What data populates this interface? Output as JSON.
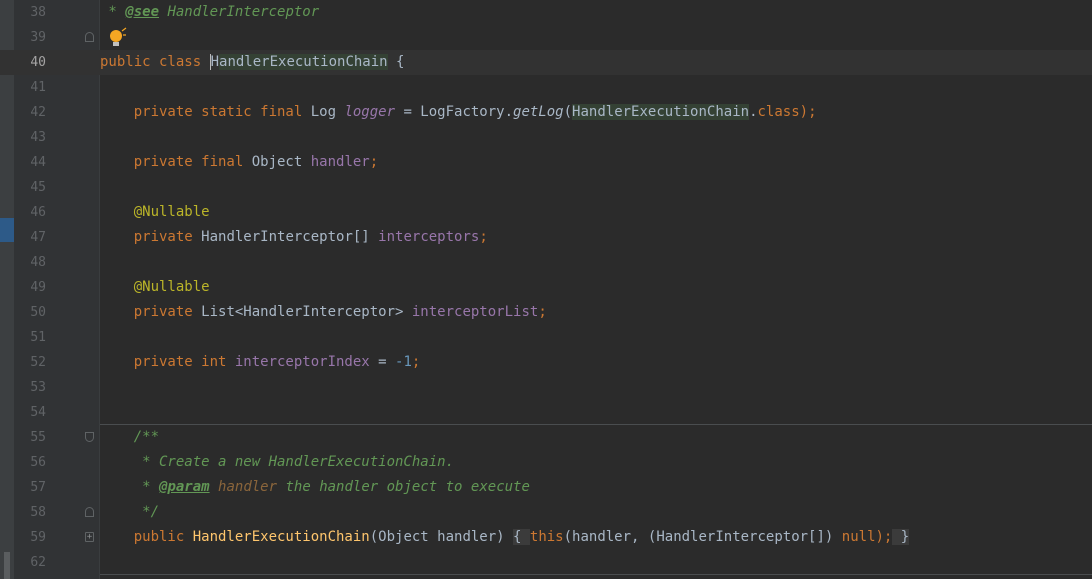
{
  "editor": {
    "lines": [
      {
        "num": "38",
        "parts": [
          {
            "t": " * ",
            "c": "doc"
          },
          {
            "t": "@see",
            "c": "doctag"
          },
          {
            "t": " HandlerInterceptor",
            "c": "doc"
          }
        ]
      },
      {
        "num": "39",
        "parts": [],
        "bulb": true,
        "fold": "up"
      },
      {
        "num": "40",
        "current": true,
        "parts": [
          {
            "t": "public class ",
            "c": "kw"
          },
          {
            "t": "H",
            "c": "caret"
          },
          {
            "t": "andlerExecutionChain",
            "c": "hl"
          },
          {
            "t": " {",
            "c": ""
          }
        ]
      },
      {
        "num": "41",
        "parts": []
      },
      {
        "num": "42",
        "parts": [
          {
            "t": "    private static final ",
            "c": "kw"
          },
          {
            "t": "Log ",
            "c": ""
          },
          {
            "t": "logger",
            "c": "static-field"
          },
          {
            "t": " = LogFactory.",
            "c": ""
          },
          {
            "t": "getLog",
            "c": "italic"
          },
          {
            "t": "(",
            "c": ""
          },
          {
            "t": "HandlerExecutionChain",
            "c": "hl"
          },
          {
            "t": ".",
            "c": ""
          },
          {
            "t": "class",
            "c": "kw"
          },
          {
            "t": ");",
            "c": "kw"
          }
        ]
      },
      {
        "num": "43",
        "parts": []
      },
      {
        "num": "44",
        "parts": [
          {
            "t": "    private final ",
            "c": "kw"
          },
          {
            "t": "Object ",
            "c": ""
          },
          {
            "t": "handler",
            "c": "field"
          },
          {
            "t": ";",
            "c": "kw"
          }
        ]
      },
      {
        "num": "45",
        "parts": []
      },
      {
        "num": "46",
        "parts": [
          {
            "t": "    @Nullable",
            "c": "ann"
          }
        ]
      },
      {
        "num": "47",
        "parts": [
          {
            "t": "    private ",
            "c": "kw"
          },
          {
            "t": "HandlerInterceptor[] ",
            "c": ""
          },
          {
            "t": "interceptors",
            "c": "field"
          },
          {
            "t": ";",
            "c": "kw"
          }
        ]
      },
      {
        "num": "48",
        "parts": []
      },
      {
        "num": "49",
        "parts": [
          {
            "t": "    @Nullable",
            "c": "ann"
          }
        ]
      },
      {
        "num": "50",
        "parts": [
          {
            "t": "    private ",
            "c": "kw"
          },
          {
            "t": "List<HandlerInterceptor> ",
            "c": ""
          },
          {
            "t": "interceptorList",
            "c": "field"
          },
          {
            "t": ";",
            "c": "kw"
          }
        ]
      },
      {
        "num": "51",
        "parts": []
      },
      {
        "num": "52",
        "parts": [
          {
            "t": "    private int ",
            "c": "kw"
          },
          {
            "t": "interceptorIndex",
            "c": "field"
          },
          {
            "t": " = ",
            "c": ""
          },
          {
            "t": "-1",
            "c": "num"
          },
          {
            "t": ";",
            "c": "kw"
          }
        ]
      },
      {
        "num": "53",
        "parts": []
      },
      {
        "num": "54",
        "parts": [],
        "separator": true
      },
      {
        "num": "55",
        "fold": "down",
        "parts": [
          {
            "t": "    /**",
            "c": "doc"
          }
        ]
      },
      {
        "num": "56",
        "parts": [
          {
            "t": "     * Create a new HandlerExecutionChain.",
            "c": "doc"
          }
        ]
      },
      {
        "num": "57",
        "parts": [
          {
            "t": "     * ",
            "c": "doc"
          },
          {
            "t": "@param",
            "c": "doctag"
          },
          {
            "t": " ",
            "c": "doc"
          },
          {
            "t": "handler",
            "c": "docparam"
          },
          {
            "t": " the handler object to execute",
            "c": "doc"
          }
        ]
      },
      {
        "num": "58",
        "fold": "up",
        "parts": [
          {
            "t": "     */",
            "c": "doc"
          }
        ]
      },
      {
        "num": "59",
        "fold": "plus",
        "parts": [
          {
            "t": "    public ",
            "c": "kw"
          },
          {
            "t": "HandlerExecutionChain",
            "c": "method"
          },
          {
            "t": "(Object handler) ",
            "c": ""
          },
          {
            "t": "{ ",
            "c": "brace-box"
          },
          {
            "t": "this",
            "c": "kw"
          },
          {
            "t": "(handler, ",
            "c": ""
          },
          {
            "t": "(HandlerInterceptor[]) ",
            "c": ""
          },
          {
            "t": "null",
            "c": "kw"
          },
          {
            "t": ");",
            "c": "kw"
          },
          {
            "t": " }",
            "c": "brace-box"
          }
        ]
      },
      {
        "num": "62",
        "parts": [],
        "separator": true
      }
    ]
  },
  "colors": {
    "background": "#2b2b2b",
    "keyword": "#cc7832",
    "annotation": "#bbb529",
    "field": "#9876aa",
    "doc_comment": "#629755",
    "method_decl": "#ffc66d",
    "number": "#6897bb"
  },
  "icons": {
    "intention": "lightbulb-icon",
    "fold": "fold-marker-icon"
  }
}
